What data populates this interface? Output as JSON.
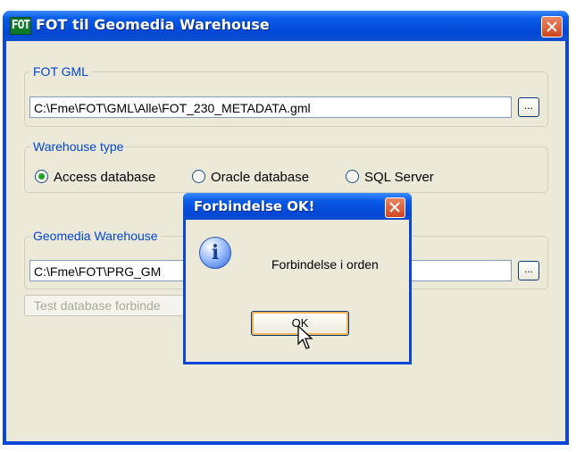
{
  "window": {
    "title": "FOT til Geomedia Warehouse",
    "icon_text": "FOT",
    "close_icon": "close-icon"
  },
  "fot_gml": {
    "legend": "FOT GML",
    "path_value": "C:\\Fme\\FOT\\GML\\Alle\\FOT_230_METADATA.gml",
    "browse_label": "..."
  },
  "warehouse_type": {
    "legend": "Warehouse type",
    "options": [
      {
        "label": "Access database",
        "selected": true
      },
      {
        "label": "Oracle database",
        "selected": false
      },
      {
        "label": "SQL Server",
        "selected": false
      }
    ]
  },
  "geomedia_warehouse": {
    "legend": "Geomedia Warehouse",
    "path_value": "C:\\Fme\\FOT\\PRG_GM",
    "browse_label": "..."
  },
  "test_button": {
    "label": "Test database forbinde"
  },
  "message_box": {
    "title": "Forbindelse OK!",
    "message": "Forbindelse i orden",
    "ok_label": "OK",
    "icon": "info-icon"
  },
  "colors": {
    "title_bar": "#0a5be6",
    "client_bg": "#ece9d8",
    "legend_text": "#0046d5",
    "close_button": "#d3451e"
  }
}
